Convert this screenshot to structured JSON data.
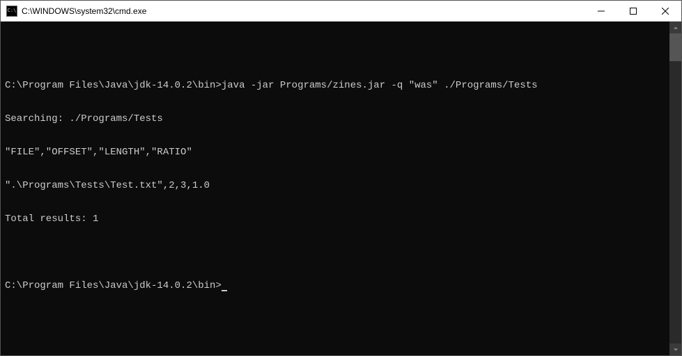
{
  "window": {
    "title": "C:\\WINDOWS\\system32\\cmd.exe"
  },
  "terminal": {
    "prompt1": "C:\\Program Files\\Java\\jdk-14.0.2\\bin>",
    "command1": "java -jar Programs/zines.jar -q \"was\" ./Programs/Tests",
    "line_searching": "Searching: ./Programs/Tests",
    "line_headers": "\"FILE\",\"OFFSET\",\"LENGTH\",\"RATIO\"",
    "line_result": "\".\\Programs\\Tests\\Test.txt\",2,3,1.0",
    "line_total": "Total results: 1",
    "prompt2": "C:\\Program Files\\Java\\jdk-14.0.2\\bin>"
  }
}
